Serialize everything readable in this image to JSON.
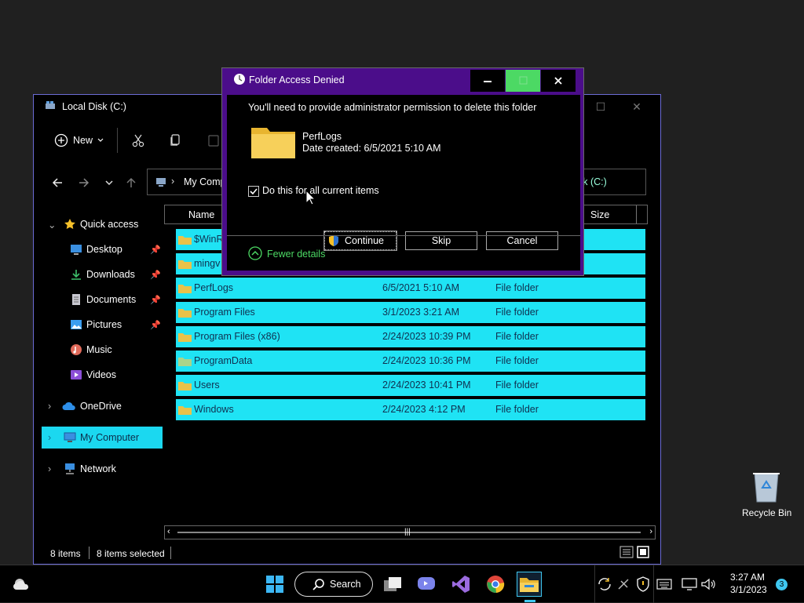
{
  "explorer": {
    "title": "Local Disk (C:)",
    "toolbar": {
      "new_label": "New"
    },
    "address": {
      "crumb": "My Comp",
      "crumb_end": "sk (C:)"
    },
    "sidebar": [
      {
        "label": "Quick access",
        "icon": "star-icon"
      },
      {
        "label": "Desktop",
        "icon": "desktop-icon",
        "pinned": true
      },
      {
        "label": "Downloads",
        "icon": "download-icon",
        "pinned": true
      },
      {
        "label": "Documents",
        "icon": "documents-icon",
        "pinned": true
      },
      {
        "label": "Pictures",
        "icon": "pictures-icon",
        "pinned": true
      },
      {
        "label": "Music",
        "icon": "music-icon"
      },
      {
        "label": "Videos",
        "icon": "videos-icon"
      },
      {
        "label": "OneDrive",
        "icon": "cloud-icon"
      },
      {
        "label": "My Computer",
        "icon": "computer-icon",
        "selected": true
      },
      {
        "label": "Network",
        "icon": "network-icon"
      }
    ],
    "columns": {
      "name": "Name",
      "size": "Size"
    },
    "rows": [
      {
        "name": "$WinR",
        "date": "",
        "type": ""
      },
      {
        "name": "mingv",
        "date": "",
        "type": ""
      },
      {
        "name": "PerfLogs",
        "date": "6/5/2021 5:10 AM",
        "type": "File folder"
      },
      {
        "name": "Program Files",
        "date": "3/1/2023 3:21 AM",
        "type": "File folder"
      },
      {
        "name": "Program Files (x86)",
        "date": "2/24/2023 10:39 PM",
        "type": "File folder"
      },
      {
        "name": "ProgramData",
        "date": "2/24/2023 10:36 PM",
        "type": "File folder"
      },
      {
        "name": "Users",
        "date": "2/24/2023 10:41 PM",
        "type": "File folder"
      },
      {
        "name": "Windows",
        "date": "2/24/2023 4:12 PM",
        "type": "File folder"
      }
    ],
    "status": {
      "items": "8 items",
      "selected": "8 items selected"
    }
  },
  "dialog": {
    "title": "Folder Access Denied",
    "message": "You'll need to provide administrator permission to delete this folder",
    "folder_name": "PerfLogs",
    "folder_date": "Date created: 6/5/2021 5:10 AM",
    "checkbox_label": "Do this for all current items",
    "continue_label": "Continue",
    "skip_label": "Skip",
    "cancel_label": "Cancel",
    "details_label": "Fewer details"
  },
  "desktop": {
    "recycle_bin": "Recycle Bin"
  },
  "taskbar": {
    "search_label": "Search",
    "time": "3:27 AM",
    "date": "3/1/2023",
    "notifications": "3"
  },
  "colors": {
    "row_highlight": "#1fe3f4",
    "dialog_border": "#4b0d8a",
    "accent_green": "#4cd964"
  }
}
